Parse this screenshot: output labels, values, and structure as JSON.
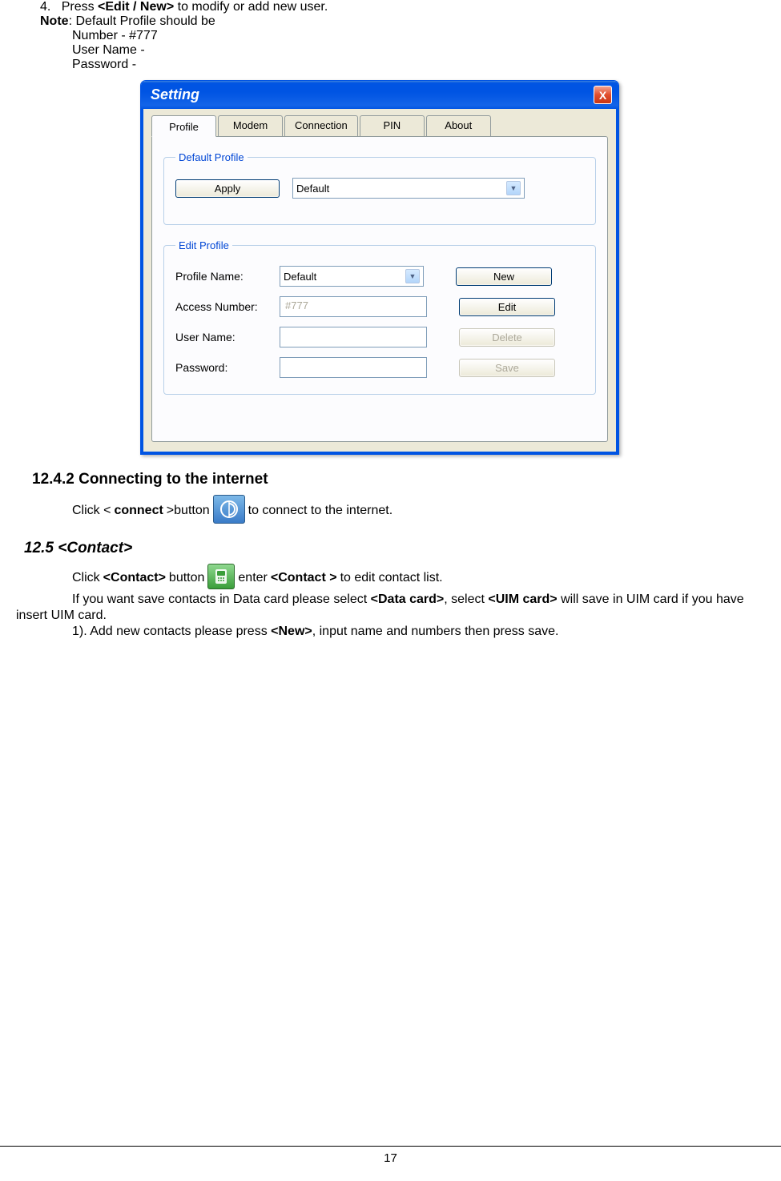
{
  "instructions": {
    "item4_num": "4.",
    "item4_pre": "Press ",
    "item4_bold": "<Edit / New>",
    "item4_post": " to modify or add new user.",
    "note_label": "Note",
    "note_text": ": Default Profile should be",
    "number_line": "Number - #777",
    "username_line": "User Name -",
    "password_line": "Password -"
  },
  "dialog": {
    "title": "Setting",
    "close": "X",
    "tabs": {
      "profile": "Profile",
      "modem": "Modem",
      "connection": "Connection",
      "pin": "PIN",
      "about": "About"
    },
    "default_profile": {
      "legend": "Default Profile",
      "apply": "Apply",
      "selected": "Default"
    },
    "edit_profile": {
      "legend": "Edit Profile",
      "profile_name_label": "Profile Name:",
      "profile_name_value": "Default",
      "access_number_label": "Access Number:",
      "access_number_value": "#777",
      "user_name_label": "User Name:",
      "user_name_value": "",
      "password_label": "Password:",
      "password_value": "",
      "new_btn": "New",
      "edit_btn": "Edit",
      "delete_btn": "Delete",
      "save_btn": "Save"
    }
  },
  "section_1242": {
    "heading": "12.4.2  Connecting to the internet",
    "pre": "Click < ",
    "bold": "connect",
    "mid": ">button",
    "post": " to connect to the internet."
  },
  "section_125": {
    "heading": "12.5  <Contact>",
    "line1_pre": "Click ",
    "line1_b1": "<Contact>",
    "line1_mid1": " button ",
    "line1_mid2": " enter ",
    "line1_b2": "<Contact >",
    "line1_post": " to edit contact list.",
    "line2_pre": "If you want save contacts in Data card please select ",
    "line2_b1": "<Data card>",
    "line2_mid": ", select ",
    "line2_b2": "<UIM card>",
    "line2_post": " will save in UIM card if you have insert UIM card.",
    "line3_pre": "1). Add new contacts please press ",
    "line3_b1": "<New>",
    "line3_post": ", input name and numbers then press save."
  },
  "footer": {
    "page_number": "17"
  }
}
